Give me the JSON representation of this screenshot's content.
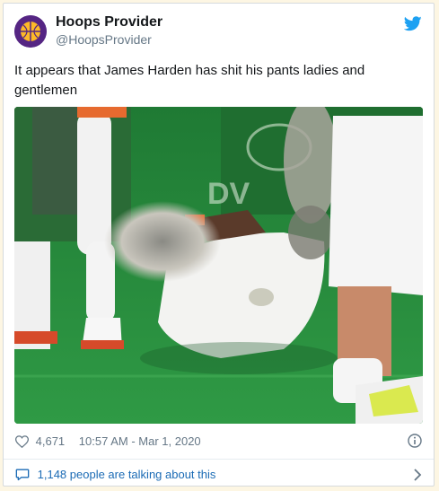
{
  "user": {
    "display_name": "Hoops Provider",
    "handle": "@HoopsProvider",
    "avatar_icon": "lakers-logo-icon",
    "brand_color": "#1da1f2"
  },
  "tweet": {
    "text": "It appears that James Harden has shit his pants ladies and gentlemen"
  },
  "media": {
    "type": "photo"
  },
  "meta": {
    "likes": "4,671",
    "timestamp": "10:57 AM - Mar 1, 2020"
  },
  "footer": {
    "talking_label": "1,148 people are talking about this",
    "link_color": "#1b6bb5"
  }
}
